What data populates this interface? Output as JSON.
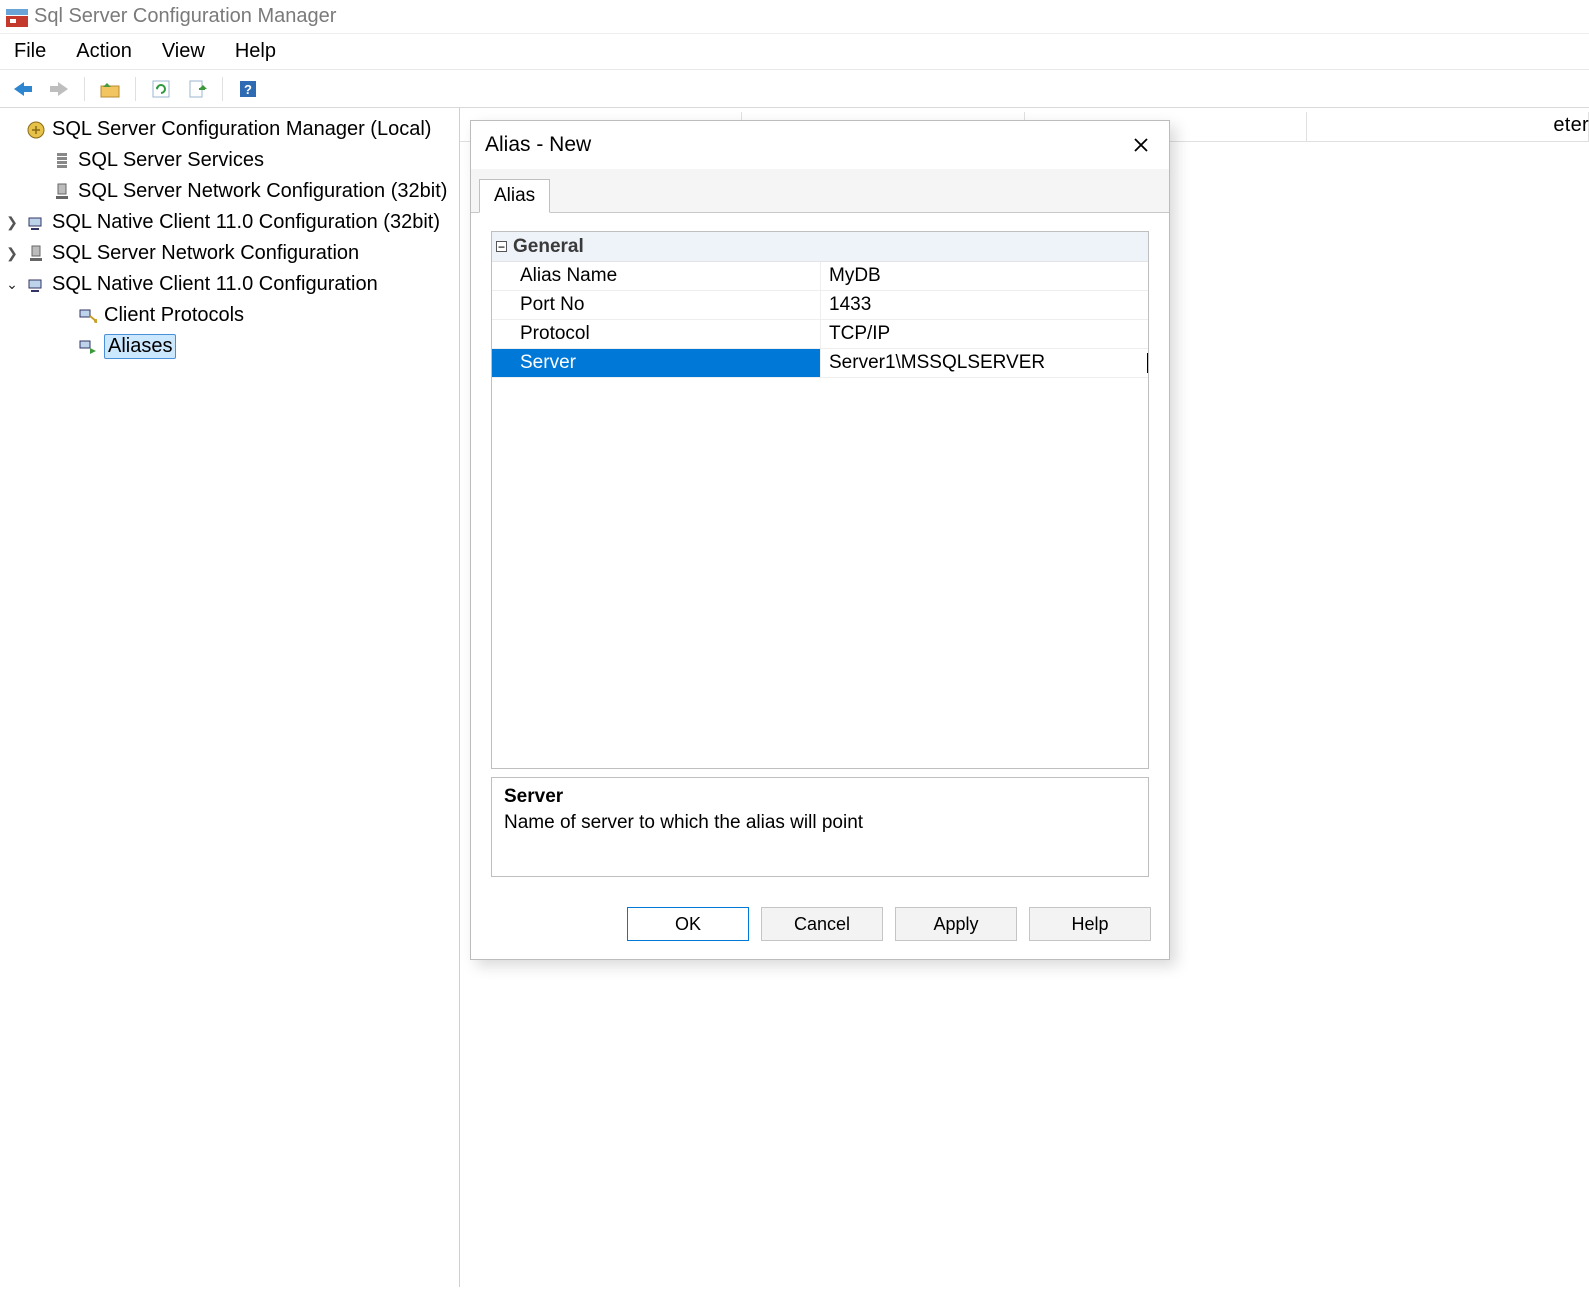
{
  "window": {
    "title": "Sql Server Configuration Manager"
  },
  "menu": {
    "file": "File",
    "action": "Action",
    "view": "View",
    "help": "Help"
  },
  "tree": {
    "root": "SQL Server Configuration Manager (Local)",
    "services": "SQL Server Services",
    "netconfig32": "SQL Server Network Configuration (32bit)",
    "nativeclient32": "SQL Native Client 11.0 Configuration (32bit)",
    "netconfig": "SQL Server Network Configuration",
    "nativeclient": "SQL Native Client 11.0 Configuration",
    "client_protocols": "Client Protocols",
    "aliases": "Aliases"
  },
  "right_stub": {
    "clipped": "eter"
  },
  "dialog": {
    "title": "Alias - New",
    "tab": "Alias",
    "category": "General",
    "props": {
      "alias_name_k": "Alias Name",
      "alias_name_v": "MyDB",
      "port_k": "Port No",
      "port_v": "1433",
      "protocol_k": "Protocol",
      "protocol_v": "TCP/IP",
      "server_k": "Server",
      "server_v": "Server1\\MSSQLSERVER"
    },
    "desc": {
      "title": "Server",
      "text": "Name of server to which the alias will point"
    },
    "buttons": {
      "ok": "OK",
      "cancel": "Cancel",
      "apply": "Apply",
      "help": "Help"
    }
  }
}
